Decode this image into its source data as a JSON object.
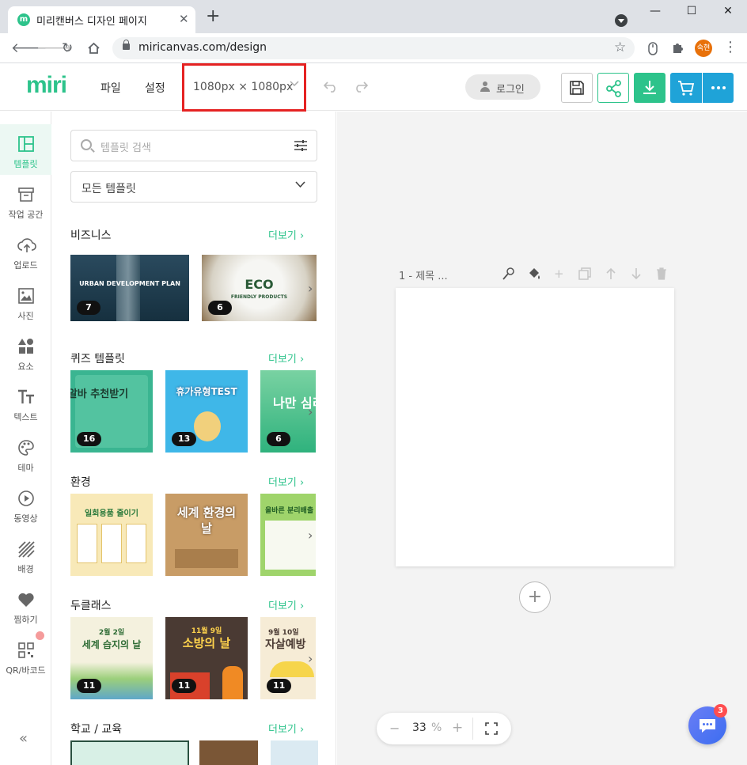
{
  "browser": {
    "tab_title": "미리캔버스 디자인 페이지",
    "tab_close": "✕",
    "new_tab": "+",
    "url": "miricanvas.com/design",
    "profile_label": "숙현",
    "win_minimize": "—",
    "win_maximize": "☐",
    "win_close": "✕"
  },
  "header": {
    "logo": "miri",
    "menu_file": "파일",
    "menu_settings": "설정",
    "size": "1080px × 1080px",
    "login": "로그인",
    "brand_green": "#2dc38b",
    "brand_blue": "#1fa3d8",
    "highlight_red": "#e52222"
  },
  "rail": {
    "items": [
      {
        "label": "템플릿",
        "icon": "template-icon",
        "active": true
      },
      {
        "label": "작업 공간",
        "icon": "archive-icon"
      },
      {
        "label": "업로드",
        "icon": "upload-icon"
      },
      {
        "label": "사진",
        "icon": "photo-icon"
      },
      {
        "label": "요소",
        "icon": "elements-icon"
      },
      {
        "label": "텍스트",
        "icon": "text-icon"
      },
      {
        "label": "테마",
        "icon": "palette-icon"
      },
      {
        "label": "동영상",
        "icon": "video-icon"
      },
      {
        "label": "배경",
        "icon": "background-icon"
      },
      {
        "label": "찜하기",
        "icon": "heart-icon"
      },
      {
        "label": "QR/바코드",
        "icon": "qr-icon"
      }
    ],
    "collapse": "«"
  },
  "panel": {
    "search_placeholder": "템플릿 검색",
    "filter_selected": "모든 템플릿",
    "more_label": "더보기 ›",
    "categories": [
      {
        "title": "비즈니스",
        "thumbs": [
          {
            "count": "7",
            "text": "URBAN DEVELOPMENT PLAN"
          },
          {
            "count": "6",
            "text": "ECO",
            "sub": "FRIENDLY PRODUCTS"
          }
        ]
      },
      {
        "title": "퀴즈 템플릿",
        "thumbs": [
          {
            "count": "16",
            "text": "꿀알바 추천받기"
          },
          {
            "count": "13",
            "text": "휴가유형TEST"
          },
          {
            "count": "6",
            "text": "나만 심리테"
          }
        ]
      },
      {
        "title": "환경",
        "thumbs": [
          {
            "count": "",
            "text": "일회용품 줄이기"
          },
          {
            "count": "",
            "text": "세계 환경의 날"
          },
          {
            "count": "",
            "text": "올바른 분리배출"
          }
        ]
      },
      {
        "title": "두클래스",
        "thumbs": [
          {
            "count": "11",
            "text": "세계 습지의 날",
            "pre": "2월 2일"
          },
          {
            "count": "11",
            "text": "소방의 날",
            "pre": "11월 9일"
          },
          {
            "count": "11",
            "text": "자살예방",
            "pre": "9월 10일"
          }
        ]
      },
      {
        "title": "학교 / 교육",
        "thumbs": []
      }
    ]
  },
  "canvas": {
    "page_label": "1 - 제목 ...",
    "add_page": "+",
    "zoom_value": "33",
    "zoom_unit": "%",
    "zoom_minus": "−",
    "zoom_plus": "+",
    "chat_badge": "3"
  }
}
